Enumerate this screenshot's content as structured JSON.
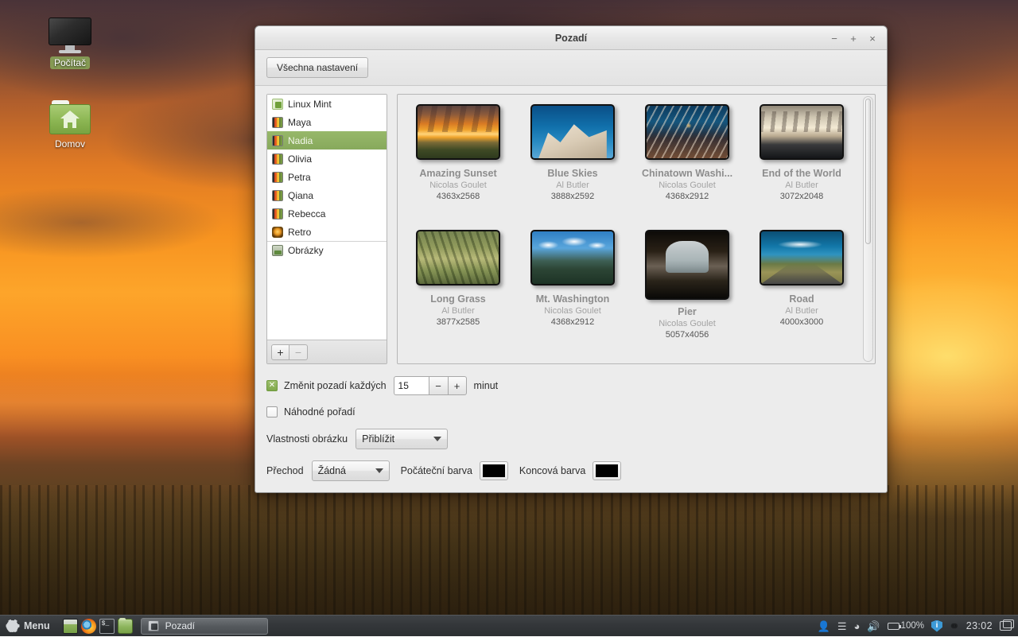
{
  "desktop": {
    "icons": [
      {
        "label": "Počítač",
        "icon": "computer-monitor-icon",
        "selected": true
      },
      {
        "label": "Domov",
        "icon": "home-folder-icon",
        "selected": false
      }
    ]
  },
  "window": {
    "title": "Pozadí",
    "buttons": {
      "minimize": "−",
      "maximize": "+",
      "close": "×"
    },
    "toolbar": {
      "all_settings_label": "Všechna nastavení"
    }
  },
  "sidebar": {
    "items": [
      {
        "label": "Linux Mint",
        "icon": "mint-logo-icon",
        "selected": false
      },
      {
        "label": "Maya",
        "icon": "wallpaper-pack-icon",
        "selected": false
      },
      {
        "label": "Nadia",
        "icon": "wallpaper-pack-icon",
        "selected": true
      },
      {
        "label": "Olivia",
        "icon": "wallpaper-pack-icon",
        "selected": false
      },
      {
        "label": "Petra",
        "icon": "wallpaper-pack-icon",
        "selected": false
      },
      {
        "label": "Qiana",
        "icon": "wallpaper-pack-icon",
        "selected": false
      },
      {
        "label": "Rebecca",
        "icon": "wallpaper-pack-icon",
        "selected": false
      },
      {
        "label": "Retro",
        "icon": "retro-disc-icon",
        "selected": false
      },
      {
        "label": "Obrázky",
        "icon": "pictures-folder-icon",
        "selected": false,
        "separator": true
      }
    ],
    "add_label": "+",
    "remove_label": "−"
  },
  "wallpapers": [
    {
      "name": "Amazing Sunset",
      "author": "Nicolas Goulet",
      "size": "4363x2568",
      "art": "art-sunset",
      "selected": false
    },
    {
      "name": "Blue Skies",
      "author": "Al Butler",
      "size": "3888x2592",
      "art": "art-blue",
      "selected": false
    },
    {
      "name": "Chinatown Washi...",
      "author": "Nicolas Goulet",
      "size": "4368x2912",
      "art": "art-chinatown",
      "selected": false
    },
    {
      "name": "End of the World",
      "author": "Al Butler",
      "size": "3072x2048",
      "art": "art-endworld",
      "selected": false
    },
    {
      "name": "Long Grass",
      "author": "Al Butler",
      "size": "3877x2585",
      "art": "art-grass",
      "selected": false
    },
    {
      "name": "Mt. Washington",
      "author": "Nicolas Goulet",
      "size": "4368x2912",
      "art": "art-mtwash",
      "selected": false
    },
    {
      "name": "Pier",
      "author": "Nicolas Goulet",
      "size": "5057x4056",
      "art": "art-pier",
      "selected": true
    },
    {
      "name": "Road",
      "author": "Al Butler",
      "size": "4000x3000",
      "art": "art-road",
      "selected": false
    }
  ],
  "settings": {
    "change_background_label": "Změnit pozadí každých",
    "change_background_checked": true,
    "interval_value": "15",
    "interval_minus": "−",
    "interval_plus": "+",
    "minutes_label": "minut",
    "random_order_label": "Náhodné pořadí",
    "random_order_checked": false,
    "picture_aspect_label": "Vlastnosti obrázku",
    "picture_aspect_value": "Přiblížit",
    "gradient_label": "Přechod",
    "gradient_value": "Žádná",
    "start_color_label": "Počáteční barva",
    "start_color_value": "#000000",
    "end_color_label": "Koncová barva",
    "end_color_value": "#000000"
  },
  "taskbar": {
    "menu_label": "Menu",
    "launchers": [
      {
        "name": "show-desktop-icon"
      },
      {
        "name": "firefox-icon"
      },
      {
        "name": "terminal-icon"
      },
      {
        "name": "file-manager-icon"
      }
    ],
    "window_button": "Pozadí",
    "tray": {
      "battery_percent": "100%",
      "clock": "23:02"
    }
  }
}
